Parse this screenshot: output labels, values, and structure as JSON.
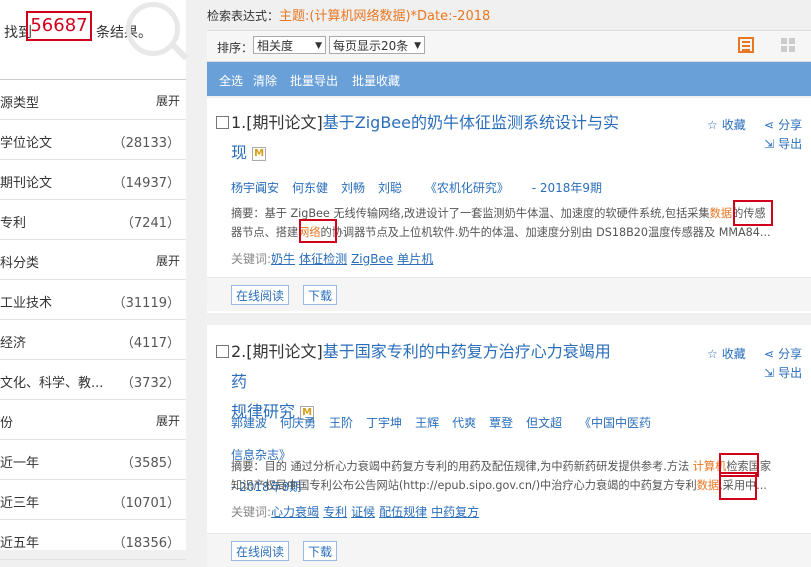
{
  "summary": {
    "prefix": "找到",
    "count": "56687",
    "suffix": "条结果。"
  },
  "facets": [
    {
      "type": "head",
      "label": "源类型",
      "action": "展开"
    },
    {
      "type": "item",
      "label": "学位论文",
      "count": "（28133）"
    },
    {
      "type": "item",
      "label": "期刊论文",
      "count": "（14937）"
    },
    {
      "type": "item",
      "label": "专利",
      "count": "（7241）"
    },
    {
      "type": "head",
      "label": "科分类",
      "action": "展开"
    },
    {
      "type": "item",
      "label": "工业技术",
      "count": "（31119）"
    },
    {
      "type": "item",
      "label": "经济",
      "count": "（4117）"
    },
    {
      "type": "item",
      "label": "文化、科学、教...",
      "count": "（3732）"
    },
    {
      "type": "head",
      "label": "份",
      "action": "展开"
    },
    {
      "type": "item",
      "label": "近一年",
      "count": "（3585）"
    },
    {
      "type": "item",
      "label": "近三年",
      "count": "（10701）"
    },
    {
      "type": "item",
      "label": "近五年",
      "count": "（18356）"
    }
  ],
  "expression": {
    "label": "检索表达式：",
    "value": "主题:(计算机网络数据)*Date:-2018"
  },
  "sort": {
    "label": "排序：",
    "sort_value": "相关度",
    "page_size": "每页显示20条"
  },
  "actions": {
    "select_all": "全选",
    "clear": "清除",
    "batch_export": "批量导出",
    "batch_collect": "批量收藏"
  },
  "results": [
    {
      "index": "1.",
      "type": "[期刊论文]",
      "title_line1": "基于ZigBee的奶牛体征监测系统设计与实",
      "title_line2": "现",
      "authors": [
        "杨宇阗安",
        "何东健",
        "刘畅",
        "刘聪"
      ],
      "source": "《农机化研究》",
      "date": "- 2018年9期",
      "abstract_line1_a": "摘要：基于 ZigBee 无线传输网络,改进设计了一套监测奶牛体温、加速度的软硬件系统,包括采集",
      "abstract_line1_hl": "数据",
      "abstract_line1_b": "的传感",
      "abstract_line2_a": "器节点、搭建",
      "abstract_line2_hl": "网络",
      "abstract_line2_b": "的协调器节点及上位机软件.奶牛的体温、加速度分别由 DS18B20温度传感器及 MMA84...",
      "keywords_label": "关键词:",
      "keywords": [
        "奶牛",
        "体征检测",
        "ZigBee",
        "单片机"
      ],
      "collect": "收藏",
      "share": "分享",
      "export": "导出",
      "read_online": "在线阅读",
      "download": "下载"
    },
    {
      "index": "2.",
      "type": "[期刊论文]",
      "title_line1": "基于国家专利的中药复方治疗心力衰竭用药",
      "title_line2": "规律研究",
      "authors": [
        "郭建波",
        "何庆勇",
        "王阶",
        "丁宇坤",
        "王辉",
        "代爽",
        "覃登",
        "但文超"
      ],
      "source": "《中国中医药信息杂志》",
      "date": "- 2018年8期",
      "abstract_line1_a": "摘要：目的 通过分析心力衰竭中药复方专利的用药及配伍规律,为中药新药研发提供参考.方法 ",
      "abstract_line1_hl": "计算机",
      "abstract_line1_b": "检索国家",
      "abstract_line2_a": "知识产权局中国专利公布公告网站(http://epub.sipo.gov.cn/)中治疗心力衰竭的中药复方专利",
      "abstract_line2_hl": "数据",
      "abstract_line2_b": ",采用中...",
      "keywords_label": "关键词:",
      "keywords": [
        "心力衰竭",
        "专利",
        "证候",
        "配伍规律",
        "中药复方"
      ],
      "collect": "收藏",
      "share": "分享",
      "export": "导出",
      "read_online": "在线阅读",
      "download": "下载"
    }
  ],
  "icons": {
    "search": "magnifier-icon",
    "list_view": "list-view-icon",
    "grid_view": "grid-view-icon",
    "star": "star-icon",
    "share": "share-icon",
    "export": "export-icon",
    "mendeley": "m-icon"
  },
  "colors": {
    "accent": "#e87722",
    "link": "#2a6ebb",
    "highlight_box": "#d0021b",
    "action_bar": "#6aa0d8"
  }
}
